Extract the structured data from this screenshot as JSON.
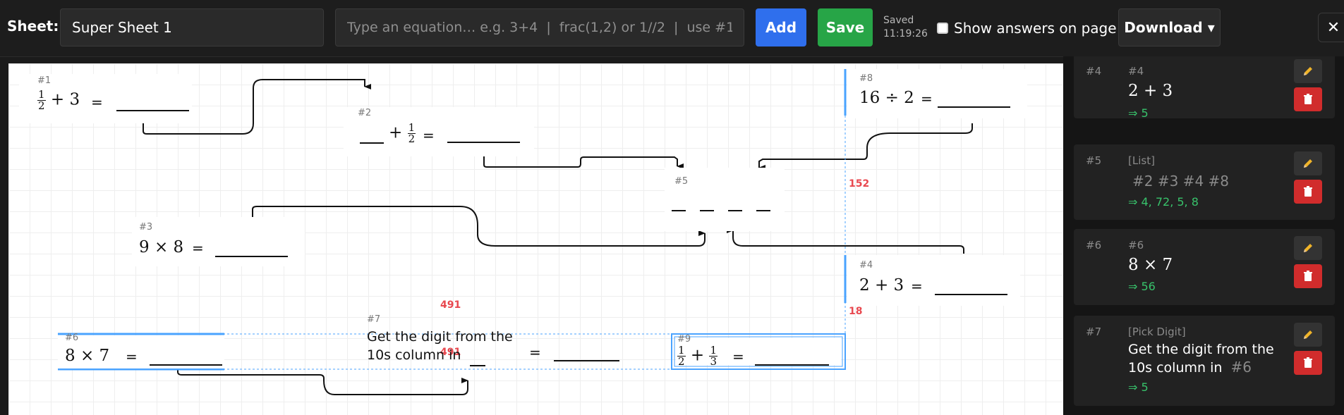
{
  "toolbar": {
    "sheet_label": "Sheet:",
    "sheet_name": "Super Sheet 1",
    "equation_placeholder": "Type an equation… e.g. 3+4  |  frac(1,2) or 1//2  |  use #1 to reference",
    "add_label": "Add",
    "save_label": "Save",
    "saved_status": "Saved",
    "saved_time": "11:19:26",
    "show_answers_label": "Show answers on page",
    "show_answers_checked": false,
    "download_label": "Download ▾",
    "close_label": "✕"
  },
  "canvas": {
    "cards": {
      "c1": {
        "id": "#1",
        "num": "1",
        "den": "2",
        "rest": "+ 3",
        "eq": "="
      },
      "c2": {
        "id": "#2",
        "op": "+",
        "num": "1",
        "den": "2",
        "eq": "="
      },
      "c3": {
        "id": "#3",
        "expr": "9 × 8",
        "eq": "="
      },
      "c4": {
        "id": "#4",
        "expr": "2 + 3",
        "eq": "="
      },
      "c5": {
        "id": "#5"
      },
      "c6": {
        "id": "#6",
        "expr": "8 × 7",
        "eq": "="
      },
      "c7": {
        "id": "#7",
        "text_line1": "Get the digit from the",
        "text_line2": "10s column in",
        "eq": "="
      },
      "c8": {
        "id": "#8",
        "expr": "16 ÷ 2",
        "eq": "="
      },
      "c9": {
        "id": "#9",
        "num1": "1",
        "den1": "2",
        "op": "+",
        "num2": "1",
        "den2": "3",
        "eq": "="
      }
    },
    "guides": {
      "g1": "152",
      "g2": "18",
      "g3": "491",
      "g4": "491"
    }
  },
  "panel": {
    "items": [
      {
        "id": "#4",
        "tag": "#4",
        "expr": "2 + 3",
        "answer": "⇒ 5"
      },
      {
        "id": "#5",
        "tag": "[List]",
        "refs": "#2  #3  #4  #8",
        "answer": "⇒ 4, 72, 5, 8"
      },
      {
        "id": "#6",
        "tag": "#6",
        "expr": "8 × 7",
        "answer": "⇒ 56"
      },
      {
        "id": "#7",
        "tag": "[Pick Digit]",
        "text1": "Get the digit from the",
        "text2": "10s column in",
        "ref": "#6",
        "answer": "⇒ 5"
      }
    ]
  },
  "colors": {
    "accent_blue": "#2f6fed",
    "save_green": "#27a547",
    "answer_green": "#38c26b",
    "delete_red": "#d12c2c",
    "guide_red": "#e8484f",
    "selection_blue": "#4aa3ff"
  },
  "icons": {
    "edit": "pencil-icon",
    "delete": "trash-icon",
    "close": "close-icon",
    "dropdown": "chevron-down-icon"
  }
}
